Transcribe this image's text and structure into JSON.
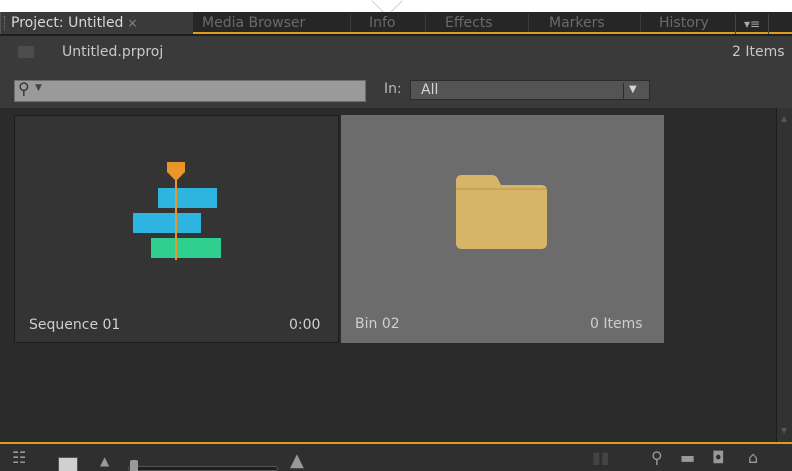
{
  "tabs": [
    {
      "label": "Project: Untitled",
      "active": true
    },
    {
      "label": "Media Browser",
      "active": false
    },
    {
      "label": "Info",
      "active": false
    },
    {
      "label": "Effects",
      "active": false
    },
    {
      "label": "Markers",
      "active": false
    },
    {
      "label": "History",
      "active": false
    }
  ],
  "tab_close_glyph": "×",
  "panel_menu_glyph": "▾≡",
  "project": {
    "file_name": "Untitled.prproj",
    "item_count": "2 Items"
  },
  "search": {
    "placeholder": "",
    "value": ""
  },
  "in_filter": {
    "label": "In:",
    "value": "All"
  },
  "items": [
    {
      "name": "Sequence 01",
      "meta": "0:00",
      "type": "sequence",
      "selected": false
    },
    {
      "name": "Bin 02",
      "meta": "0 Items",
      "type": "bin",
      "selected": true
    }
  ],
  "icons": {
    "search": "search-icon",
    "sequence": "sequence-icon",
    "bin": "folder-icon",
    "list_view": "list-view-icon",
    "icon_view": "icon-view-icon",
    "zoom_out": "small-mountain-icon",
    "zoom_in": "large-mountain-icon",
    "automate": "automate-to-sequence-icon",
    "find": "find-icon",
    "new_bin": "new-bin-icon",
    "new_item": "new-item-icon",
    "clear": "trash-icon"
  },
  "colors": {
    "accent": "#e09a1c",
    "sequence_blue": "#2db5e0",
    "sequence_green": "#2ecf8f",
    "playhead": "#e8962a",
    "folder": "#d6b568"
  }
}
